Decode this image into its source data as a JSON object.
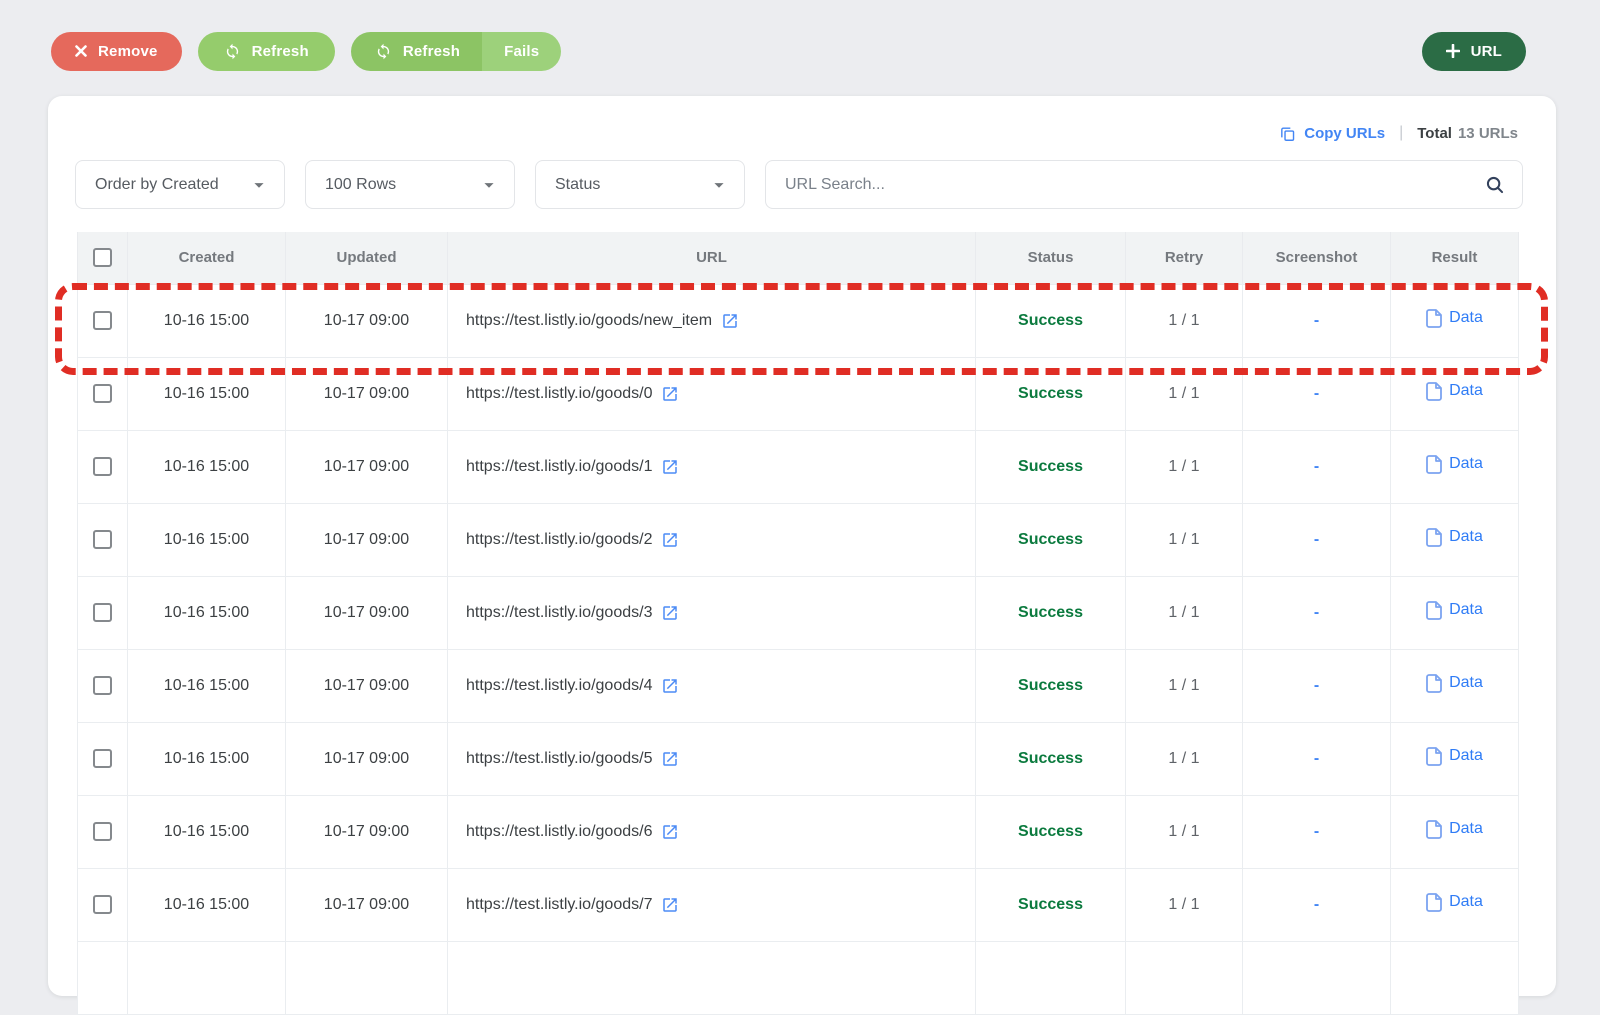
{
  "toolbar": {
    "remove_label": "Remove",
    "refresh_label": "Refresh",
    "refresh_fails": {
      "refresh_label": "Refresh",
      "fails_label": "Fails"
    },
    "add_url_label": "URL"
  },
  "summary": {
    "copy_urls_label": "Copy URLs",
    "divider": "|",
    "total_label": "Total",
    "total_count": "13 URLs"
  },
  "filters": {
    "order_by_value": "Order by Created",
    "rows_value": "100 Rows",
    "status_value": "Status",
    "search_placeholder": "URL Search..."
  },
  "table": {
    "headers": {
      "created": "Created",
      "updated": "Updated",
      "url": "URL",
      "status": "Status",
      "retry": "Retry",
      "screenshot": "Screenshot",
      "result": "Result"
    },
    "rows": [
      {
        "created": "10-16 15:00",
        "updated": "10-17 09:00",
        "url": "https://test.listly.io/goods/new_item",
        "status": "Success",
        "retry": "1 / 1",
        "screenshot": "-",
        "result": "Data",
        "highlighted": true
      },
      {
        "created": "10-16 15:00",
        "updated": "10-17 09:00",
        "url": "https://test.listly.io/goods/0",
        "status": "Success",
        "retry": "1 / 1",
        "screenshot": "-",
        "result": "Data",
        "highlighted": false
      },
      {
        "created": "10-16 15:00",
        "updated": "10-17 09:00",
        "url": "https://test.listly.io/goods/1",
        "status": "Success",
        "retry": "1 / 1",
        "screenshot": "-",
        "result": "Data",
        "highlighted": false
      },
      {
        "created": "10-16 15:00",
        "updated": "10-17 09:00",
        "url": "https://test.listly.io/goods/2",
        "status": "Success",
        "retry": "1 / 1",
        "screenshot": "-",
        "result": "Data",
        "highlighted": false
      },
      {
        "created": "10-16 15:00",
        "updated": "10-17 09:00",
        "url": "https://test.listly.io/goods/3",
        "status": "Success",
        "retry": "1 / 1",
        "screenshot": "-",
        "result": "Data",
        "highlighted": false
      },
      {
        "created": "10-16 15:00",
        "updated": "10-17 09:00",
        "url": "https://test.listly.io/goods/4",
        "status": "Success",
        "retry": "1 / 1",
        "screenshot": "-",
        "result": "Data",
        "highlighted": false
      },
      {
        "created": "10-16 15:00",
        "updated": "10-17 09:00",
        "url": "https://test.listly.io/goods/5",
        "status": "Success",
        "retry": "1 / 1",
        "screenshot": "-",
        "result": "Data",
        "highlighted": false
      },
      {
        "created": "10-16 15:00",
        "updated": "10-17 09:00",
        "url": "https://test.listly.io/goods/6",
        "status": "Success",
        "retry": "1 / 1",
        "screenshot": "-",
        "result": "Data",
        "highlighted": false
      },
      {
        "created": "10-16 15:00",
        "updated": "10-17 09:00",
        "url": "https://test.listly.io/goods/7",
        "status": "Success",
        "retry": "1 / 1",
        "screenshot": "-",
        "result": "Data",
        "highlighted": false
      }
    ],
    "has_partial_next_row": true
  },
  "colors": {
    "page_bg": "#ECEDF0",
    "remove_red": "#E5695C",
    "refresh_green": "#95CC6C",
    "split_refresh_green": "#8CC464",
    "split_fails_green": "#9DD17B",
    "add_url_green": "#2B6C45",
    "success_green": "#0B7A3E",
    "link_blue": "#2F7CF6",
    "copy_blue": "#4285F4",
    "highlight_red": "#E02D24"
  }
}
